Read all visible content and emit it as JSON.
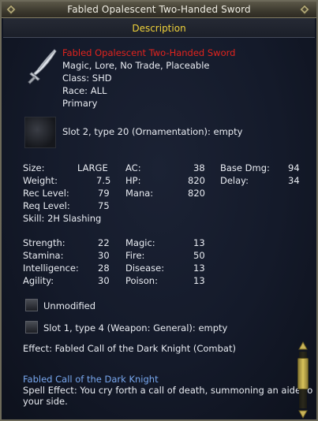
{
  "window": {
    "title": "Fabled Opalescent Two-Handed Sword"
  },
  "header": {
    "label": "Description"
  },
  "item": {
    "name": "Fabled Opalescent Two-Handed Sword",
    "flags": "Magic, Lore, No Trade, Placeable",
    "class": "Class: SHD",
    "race": "Race:  ALL",
    "slot_type": "Primary",
    "aug_slot_2": "Slot 2, type 20 (Ornamentation): empty"
  },
  "stats": {
    "col1": [
      {
        "label": "Size:",
        "value": "LARGE"
      },
      {
        "label": "Weight:",
        "value": "7.5"
      },
      {
        "label": "Rec Level:",
        "value": "79"
      },
      {
        "label": "Req Level:",
        "value": "75"
      }
    ],
    "skill": "Skill:   2H Slashing",
    "col2": [
      {
        "label": "AC:",
        "value": "38"
      },
      {
        "label": "HP:",
        "value": "820"
      },
      {
        "label": "Mana:",
        "value": "820"
      }
    ],
    "col3": [
      {
        "label": "Base Dmg:",
        "value": "94"
      },
      {
        "label": "Delay:",
        "value": "34"
      }
    ]
  },
  "attributes": {
    "col1": [
      {
        "label": "Strength:",
        "value": "22"
      },
      {
        "label": "Stamina:",
        "value": "30"
      },
      {
        "label": "Intelligence:",
        "value": "28"
      },
      {
        "label": "Agility:",
        "value": "30"
      }
    ],
    "col2": [
      {
        "label": "Magic:",
        "value": "13"
      },
      {
        "label": "Fire:",
        "value": "50"
      },
      {
        "label": "Disease:",
        "value": "13"
      },
      {
        "label": "Poison:",
        "value": "13"
      }
    ]
  },
  "status": {
    "unmodified": "Unmodified"
  },
  "aug_slot_1": "Slot 1, type 4 (Weapon: General): empty",
  "effect": "Effect: Fabled Call of the Dark Knight (Combat)",
  "spell": {
    "name": "Fabled Call of the Dark Knight",
    "line1": "Spell Effect: You cry forth a call of death, summoning an aide to",
    "line2": "your side."
  },
  "icons": {
    "item": "sword-icon",
    "corner_left": "ornament-diamond-icon",
    "corner_right": "ornament-diamond-icon"
  },
  "colors": {
    "item_name": "#e2231d",
    "header": "#f0d23a",
    "spell_name": "#78a8f0"
  }
}
